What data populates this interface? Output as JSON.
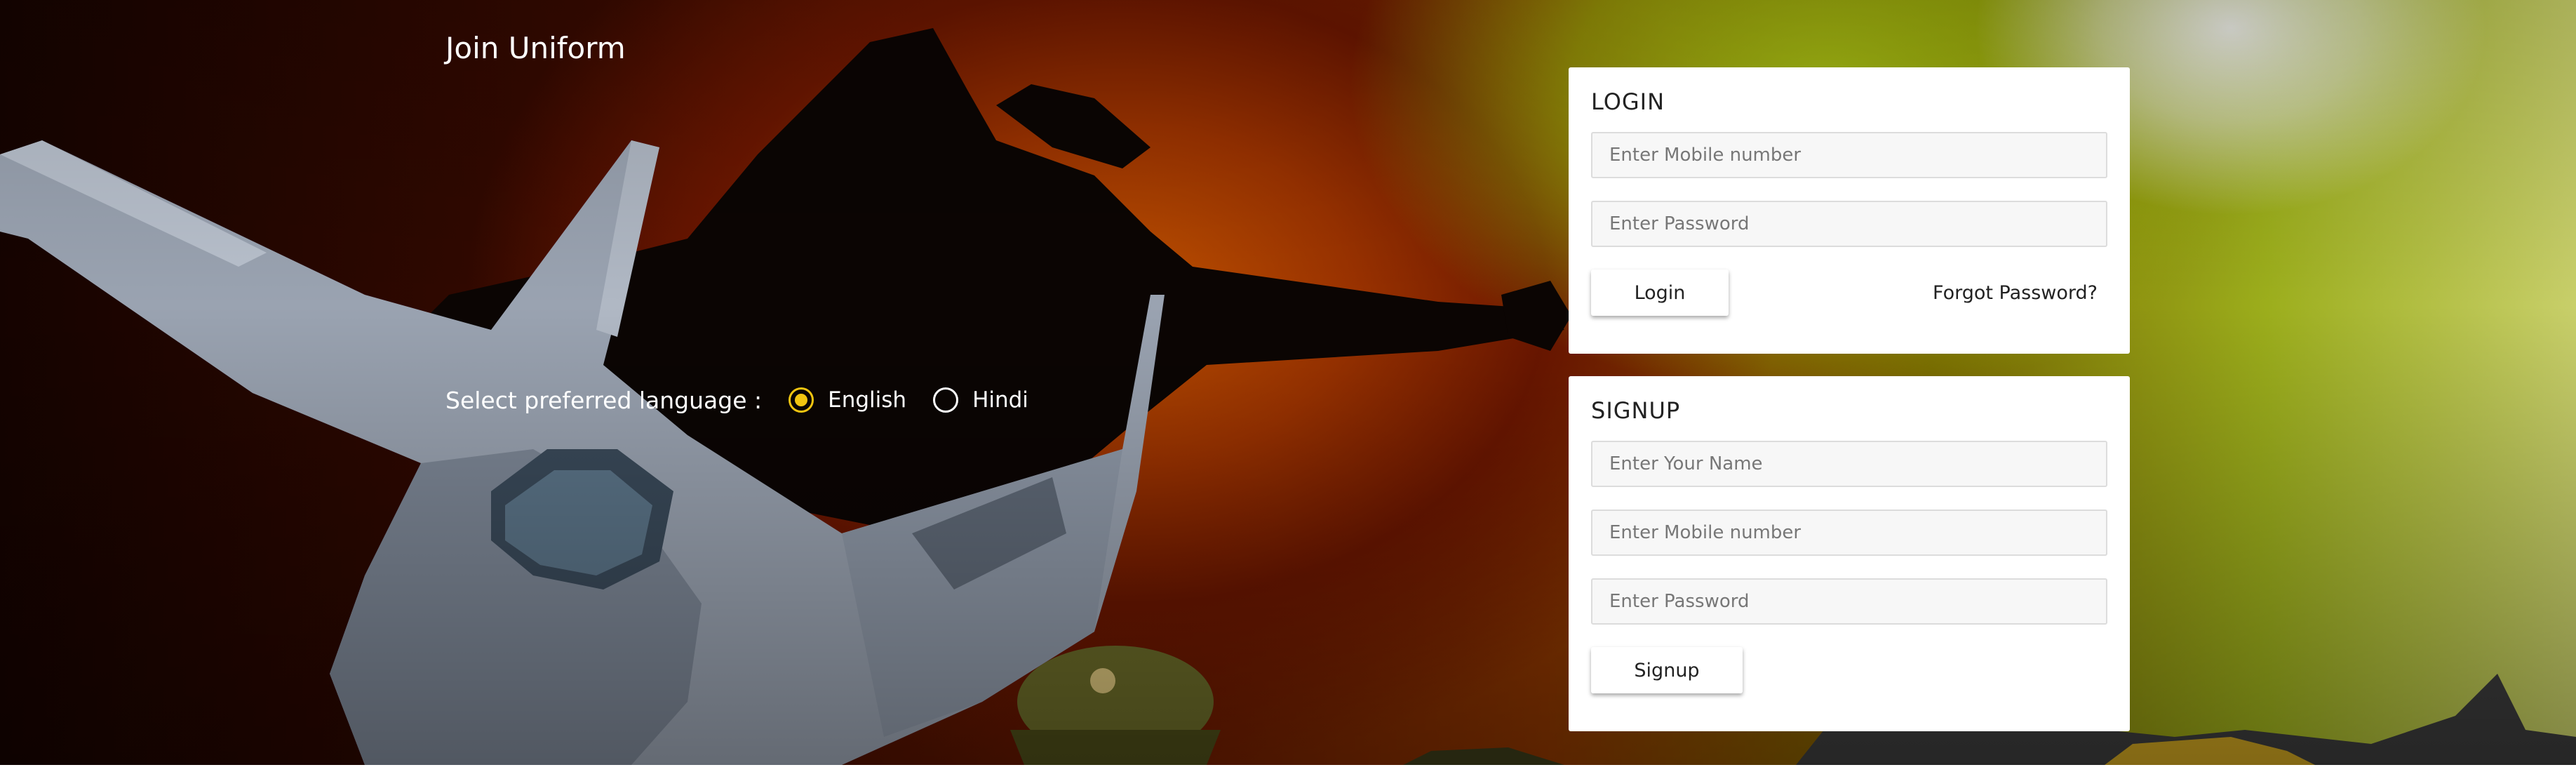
{
  "brand": {
    "title": "Join Uniform"
  },
  "language": {
    "label": "Select preferred language :",
    "options": [
      {
        "label": "English",
        "selected": true
      },
      {
        "label": "Hindi",
        "selected": false
      }
    ],
    "accent_color": "#f2c510"
  },
  "login": {
    "title": "LOGIN",
    "mobile_placeholder": "Enter Mobile number",
    "password_placeholder": "Enter Password",
    "button_label": "Login",
    "forgot_label": "Forgot Password?"
  },
  "signup": {
    "title": "SIGNUP",
    "name_placeholder": "Enter Your Name",
    "mobile_placeholder": "Enter Mobile number",
    "password_placeholder": "Enter Password",
    "button_label": "Signup"
  },
  "background": {
    "icons": [
      "fighter-jet-icon",
      "jet-silhouette-icon",
      "police-cap-icon",
      "warship-icon"
    ]
  }
}
